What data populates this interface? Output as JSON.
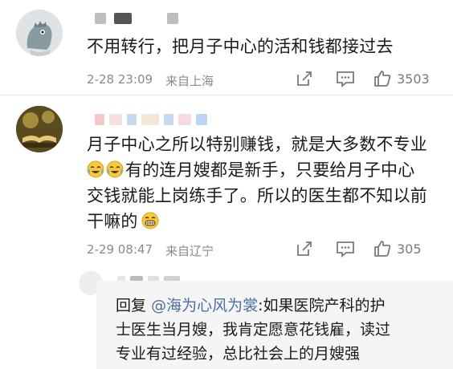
{
  "comments": [
    {
      "text": "不用转行，把月子中心的活和钱都接过去",
      "time": "2-28 23:09",
      "location": "来自上海",
      "likes": "3503"
    },
    {
      "text_line1": "月子中心之所以特别赚钱，就是大多数不专业",
      "text_line2": "有的连月嫂都是新手，只要给月子中心",
      "text_line3": "交钱就能上岗练手了。所以的医生都不知以前",
      "text_line4": "干嘛的",
      "time": "2-29 08:47",
      "location": "来自辽宁",
      "likes": "305",
      "reply": {
        "prefix": "回复",
        "mention": "@海为心风为裳",
        "text_line1": ":如果医院产科的护",
        "text_line2": "士医生当月嫂，我肯定愿意花钱雇，读过",
        "text_line3": "专业有过经验，总比社会上的月嫂强"
      }
    }
  ],
  "colors": {
    "mention": "#4a6fa5",
    "meta": "#8a8a8a"
  },
  "icons": [
    "share-icon",
    "comment-icon",
    "like-icon",
    "crying-laughing-emoji",
    "grinning-emoji"
  ]
}
